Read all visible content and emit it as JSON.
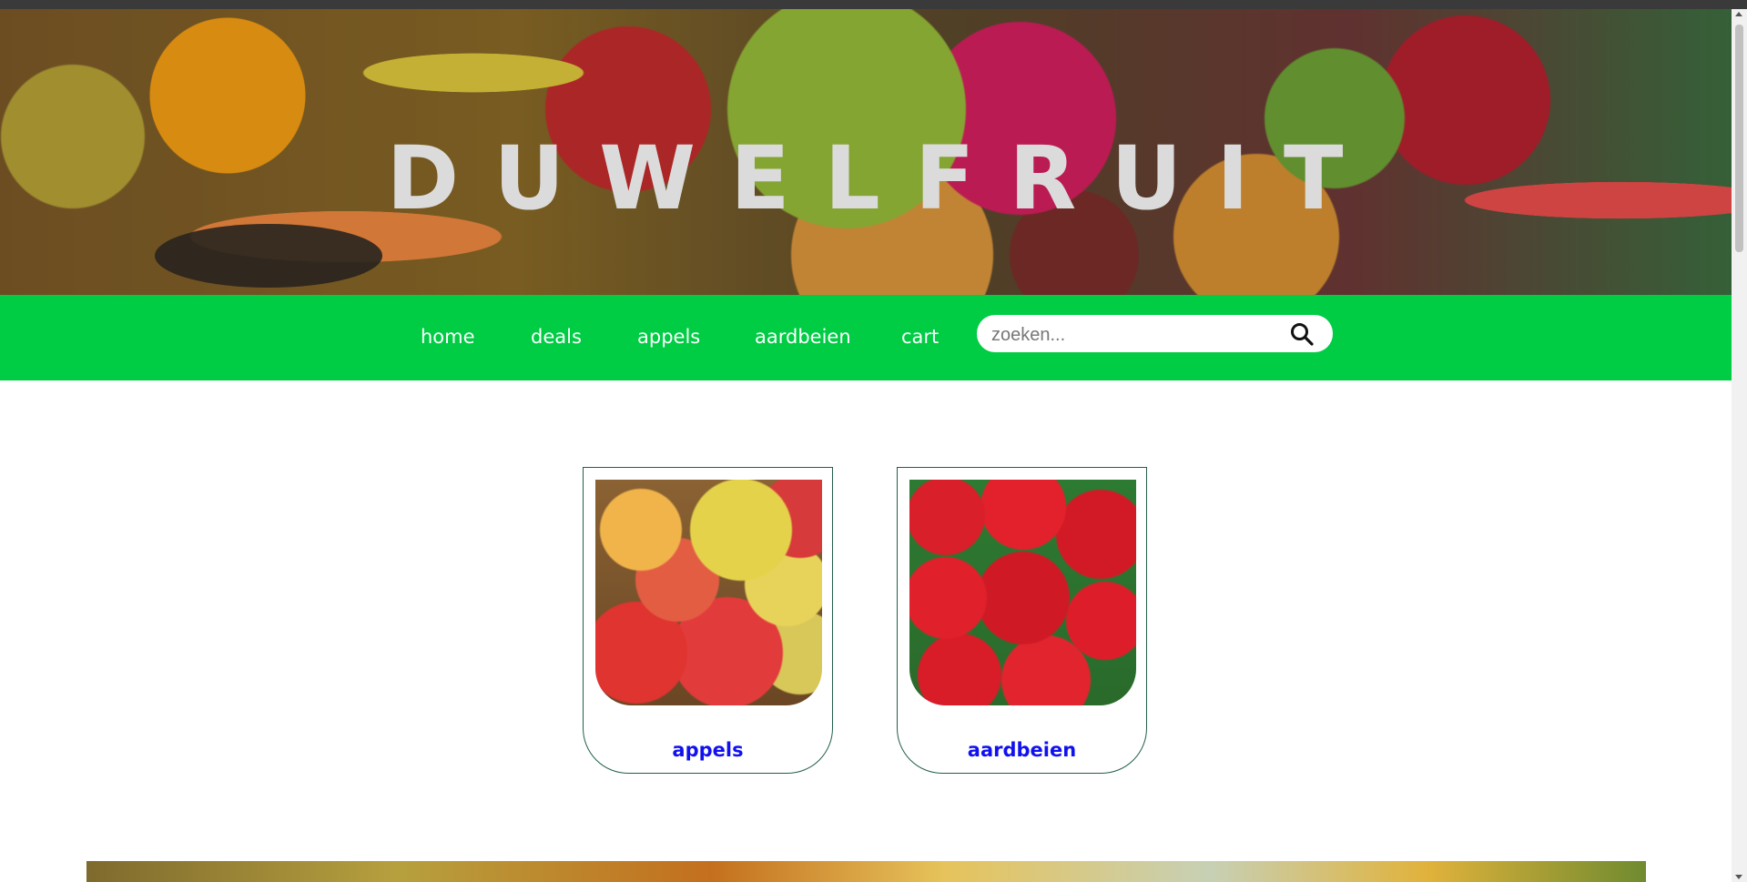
{
  "header": {
    "title": "DUWELFRUIT"
  },
  "nav": {
    "items": [
      {
        "label": "home"
      },
      {
        "label": "deals"
      },
      {
        "label": "appels"
      },
      {
        "label": "aardbeien"
      },
      {
        "label": "cart"
      }
    ]
  },
  "search": {
    "placeholder": "zoeken...",
    "value": ""
  },
  "categories": [
    {
      "label": "appels",
      "image": "apples-photo"
    },
    {
      "label": "aardbeien",
      "image": "strawberries-photo"
    }
  ],
  "colors": {
    "nav_background": "#00cc44",
    "card_border": "#215e4b",
    "card_label": "#1111ee"
  },
  "icons": {
    "search": "search-icon"
  }
}
